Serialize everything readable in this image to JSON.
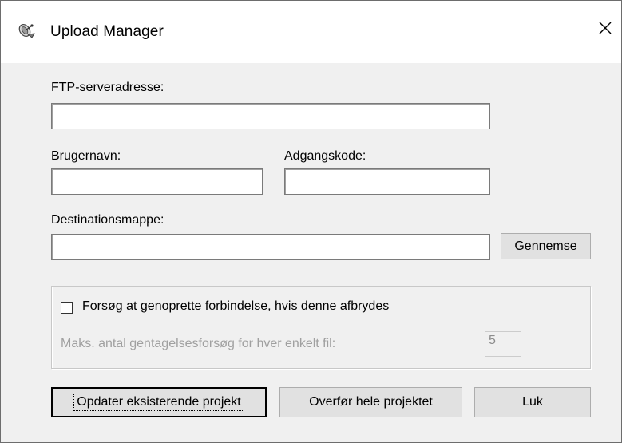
{
  "window": {
    "title": "Upload Manager",
    "app_icon": "satellite-dish-icon",
    "close_icon": "close-icon"
  },
  "form": {
    "ftp_label": "FTP-serveradresse:",
    "ftp_value": "",
    "username_label": "Brugernavn:",
    "username_value": "",
    "password_label": "Adgangskode:",
    "password_value": "",
    "destination_label": "Destinationsmappe:",
    "destination_value": "",
    "browse_label": "Gennemse"
  },
  "retry": {
    "checkbox_label": "Forsøg at genoprette forbindelse, hvis denne afbrydes",
    "checked": false,
    "max_retries_label": "Maks. antal gentagelsesforsøg for hver enkelt fil:",
    "max_retries_value": "5"
  },
  "buttons": {
    "update_existing": "Opdater eksisterende projekt",
    "transfer_all": "Overfør hele projektet",
    "close": "Luk"
  }
}
